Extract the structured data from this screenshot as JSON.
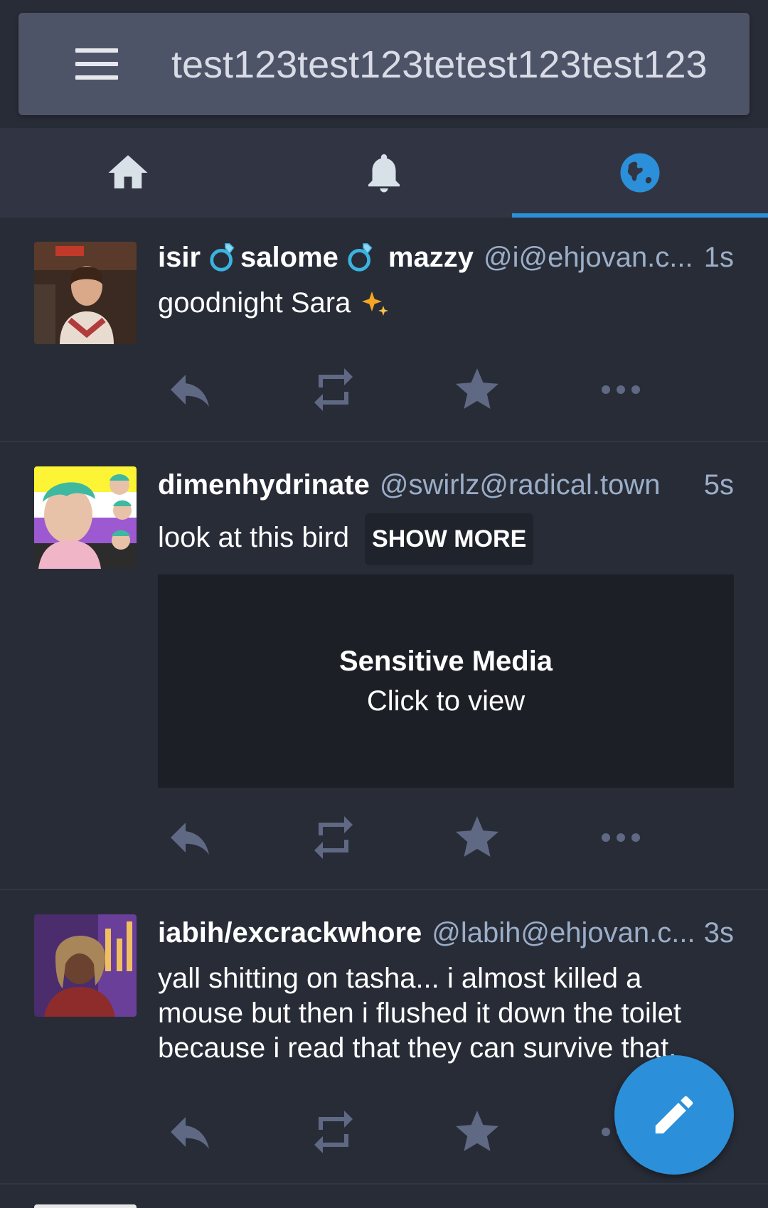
{
  "search": {
    "value": "test123test123tetest123test123"
  },
  "tabs": [
    {
      "name": "home",
      "icon": "home-icon",
      "active": false
    },
    {
      "name": "notifications",
      "icon": "bell-icon",
      "active": false
    },
    {
      "name": "federated",
      "icon": "globe-icon",
      "active": true
    }
  ],
  "statuses": [
    {
      "display_name_parts": [
        "isir",
        "salome",
        "mazzy"
      ],
      "account": "@i@ehjovan.c...",
      "time": "1s",
      "content": "goodnight Sara"
    },
    {
      "display_name": "dimenhydrinate",
      "account": "@swirlz@radical.town",
      "time": "5s",
      "content": "look at this bird",
      "show_more_label": "SHOW MORE",
      "sensitive_title": "Sensitive Media",
      "sensitive_subtitle": "Click to view"
    },
    {
      "display_name": "iabih/excrackwhore",
      "account": "@labih@ehjovan.c...",
      "time": "3s",
      "content": "yall shitting on tasha... i almost killed a mouse but then i flushed it down the toilet because i read that they can survive that."
    }
  ],
  "colors": {
    "accent": "#2b90d9",
    "background": "#282c37",
    "muted_icon": "#606984",
    "secondary_text": "#9baec8"
  }
}
